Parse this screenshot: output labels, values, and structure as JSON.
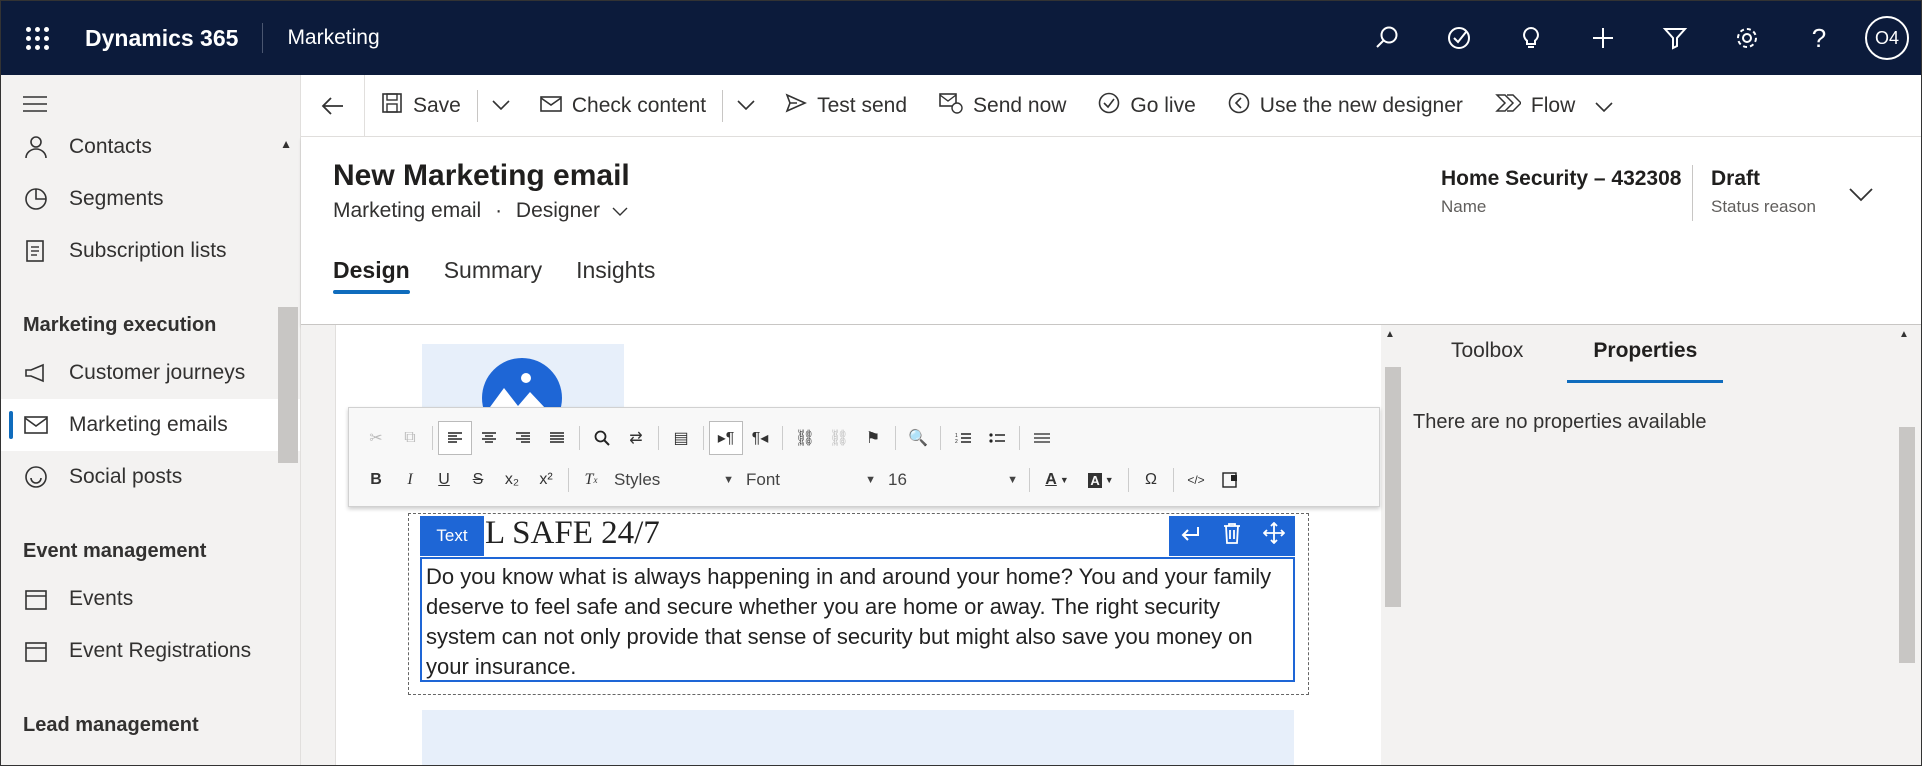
{
  "topbar": {
    "brand": "Dynamics 365",
    "app": "Marketing",
    "avatar_initials": "O4",
    "icons": [
      "search-icon",
      "task-icon",
      "lightbulb-icon",
      "plus-icon",
      "filter-icon",
      "settings-icon",
      "help-icon"
    ]
  },
  "sidebar": {
    "items_top": [
      {
        "label": "Contacts",
        "icon": "person-icon"
      },
      {
        "label": "Segments",
        "icon": "pie-icon"
      },
      {
        "label": "Subscription lists",
        "icon": "list-icon"
      }
    ],
    "group_execution": "Marketing execution",
    "items_execution": [
      {
        "label": "Customer journeys",
        "icon": "megaphone-icon"
      },
      {
        "label": "Marketing emails",
        "icon": "mail-icon",
        "active": true
      },
      {
        "label": "Social posts",
        "icon": "smile-icon"
      }
    ],
    "group_events": "Event management",
    "items_events": [
      {
        "label": "Events",
        "icon": "calendar-icon"
      },
      {
        "label": "Event Registrations",
        "icon": "calendar-icon"
      }
    ],
    "group_lead": "Lead management"
  },
  "commands": {
    "save": "Save",
    "check_content": "Check content",
    "test_send": "Test send",
    "send_now": "Send now",
    "go_live": "Go live",
    "use_new_designer": "Use the new designer",
    "flow": "Flow"
  },
  "header": {
    "title": "New Marketing email",
    "entity": "Marketing email",
    "separator": "·",
    "form": "Designer",
    "name_value": "Home Security – 432308",
    "name_label": "Name",
    "status_value": "Draft",
    "status_label": "Status reason",
    "tabs": [
      "Design",
      "Summary",
      "Insights"
    ]
  },
  "editor": {
    "toolbar": {
      "styles": "Styles",
      "font": "Font",
      "size": "16"
    },
    "text_tag": "Text",
    "heading": "L SAFE 24/7",
    "body": "Do you know what is always happening in and around your home? You and your family deserve to feel safe and secure whether you are home or away. The right security system can not only provide that sense of security but might also save you money on your insurance."
  },
  "right_panel": {
    "tabs": [
      "Toolbox",
      "Properties"
    ],
    "empty_message": "There are no properties available"
  },
  "colors": {
    "topbar": "#0c1b3b",
    "accent": "#0f6cbd",
    "editor_blue": "#1e66d6"
  }
}
